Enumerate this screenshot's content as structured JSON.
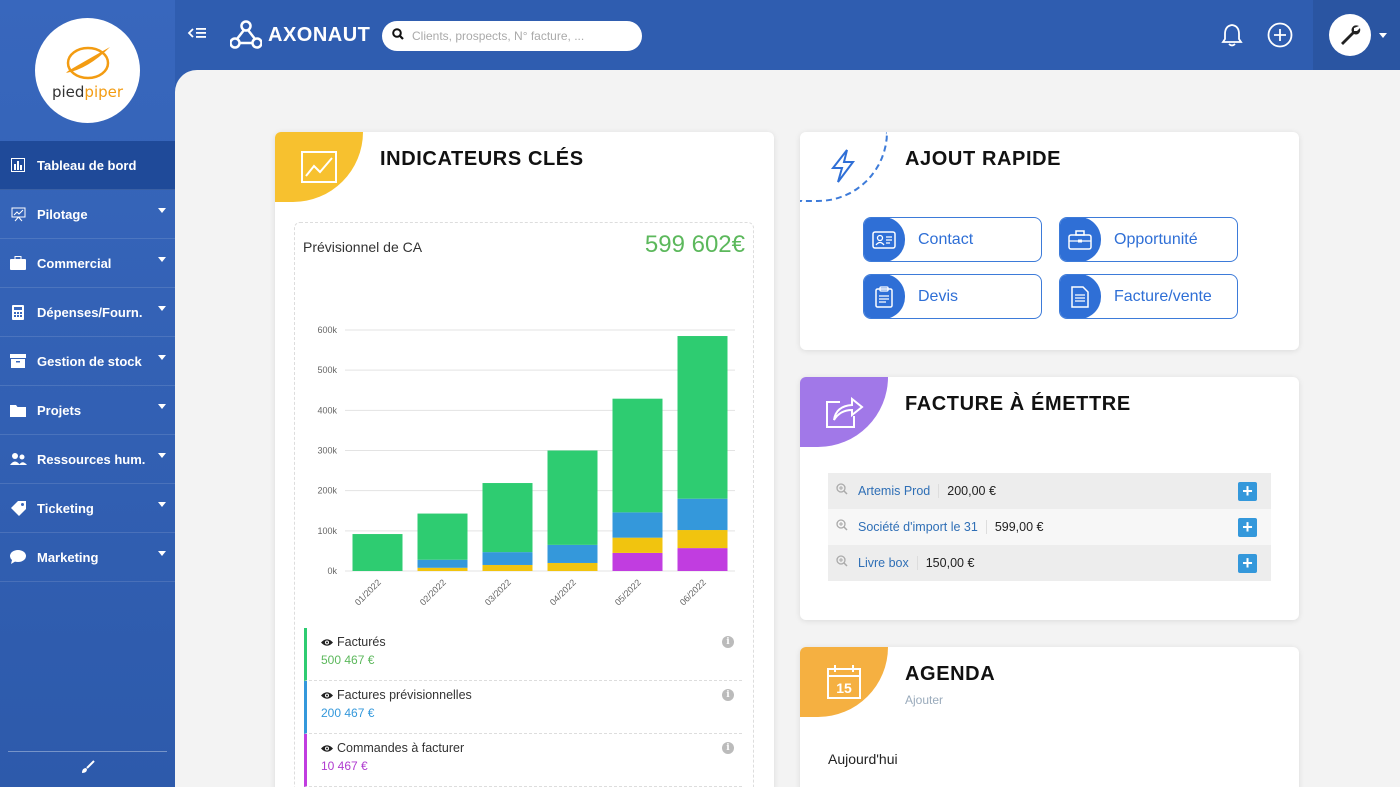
{
  "sidebar": {
    "logo": {
      "name_part1": "pied",
      "name_part2": "piper"
    },
    "items": [
      {
        "label": "Tableau de bord",
        "icon": "bar-chart-icon",
        "active": true
      },
      {
        "label": "Pilotage",
        "icon": "presentation-icon"
      },
      {
        "label": "Commercial",
        "icon": "briefcase-icon"
      },
      {
        "label": "Dépenses/Fourn.",
        "icon": "calculator-icon"
      },
      {
        "label": "Gestion de stock",
        "icon": "archive-icon"
      },
      {
        "label": "Projets",
        "icon": "folder-icon"
      },
      {
        "label": "Ressources hum.",
        "icon": "users-icon"
      },
      {
        "label": "Ticketing",
        "icon": "tag-icon"
      },
      {
        "label": "Marketing",
        "icon": "chat-icon"
      }
    ]
  },
  "topbar": {
    "brand": "AXONAUT",
    "search_placeholder": "Clients, prospects, N° facture, ..."
  },
  "indicateurs": {
    "title": "INDICATEURS CLÉS",
    "kpi_label": "Prévisionnel de CA",
    "kpi_value": "599 602€",
    "legend": [
      {
        "name": "Facturés",
        "value": "500 467 €",
        "color": "#2ecc71"
      },
      {
        "name": "Factures prévisionnelles",
        "value": "200 467 €",
        "color": "#3498db"
      },
      {
        "name": "Commandes à facturer",
        "value": "10 467 €",
        "color": "#c13de0"
      }
    ]
  },
  "chart_data": {
    "type": "bar",
    "stacked": true,
    "categories": [
      "01/2022",
      "02/2022",
      "03/2022",
      "04/2022",
      "05/2022",
      "06/2022"
    ],
    "y_ticks": [
      "0k",
      "100k",
      "200k",
      "300k",
      "400k",
      "500k",
      "600k"
    ],
    "ylim": [
      0,
      600000
    ],
    "series": [
      {
        "key": "purple",
        "color": "#c13de0",
        "values": [
          0,
          0,
          0,
          0,
          45000,
          57000
        ]
      },
      {
        "key": "yellow",
        "color": "#f1c40f",
        "values": [
          0,
          8000,
          15000,
          20000,
          38000,
          45000
        ]
      },
      {
        "key": "blue",
        "color": "#3498db",
        "values": [
          0,
          20000,
          32000,
          45000,
          63000,
          78000
        ]
      },
      {
        "key": "green",
        "color": "#2ecc71",
        "values": [
          92000,
          115000,
          172000,
          235000,
          283000,
          405000
        ]
      }
    ],
    "grid": true
  },
  "ajout": {
    "title": "AJOUT RAPIDE",
    "buttons": [
      {
        "label": "Contact",
        "icon": "contact-card-icon"
      },
      {
        "label": "Opportunité",
        "icon": "briefcase-icon"
      },
      {
        "label": "Devis",
        "icon": "clipboard-icon"
      },
      {
        "label": "Facture/vente",
        "icon": "document-icon"
      }
    ]
  },
  "facture": {
    "title": "FACTURE À ÉMETTRE",
    "rows": [
      {
        "client": "Artemis Prod",
        "amount": "200,00 €"
      },
      {
        "client": "Société d'import le 31",
        "amount": "599,00 €"
      },
      {
        "client": "Livre box",
        "amount": "150,00 €"
      }
    ]
  },
  "agenda": {
    "title": "AGENDA",
    "add_label": "Ajouter",
    "badge_day": "15",
    "today_label": "Aujourd'hui"
  },
  "colors": {
    "sidebar": "#3867bd",
    "accent_yellow": "#f7c12f",
    "accent_purple": "#a178e8",
    "accent_orange": "#f5b041",
    "quick_blue": "#2f6fd6"
  }
}
